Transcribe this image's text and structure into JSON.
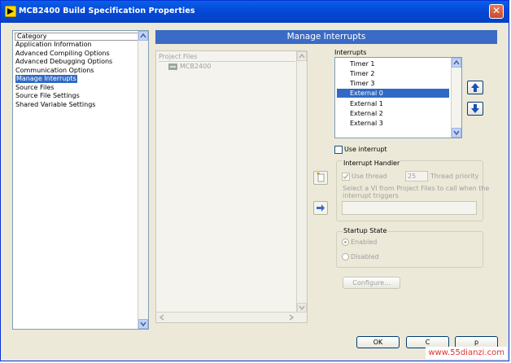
{
  "window": {
    "title": "MCB2400 Build Specification Properties"
  },
  "category": {
    "header": "Category",
    "items": [
      "Application Information",
      "Advanced Compiling Options",
      "Advanced Debugging Options",
      "Communication Options",
      "Manage Interrupts",
      "Source Files",
      "Source File Settings",
      "Shared Variable Settings"
    ],
    "selected": "Manage Interrupts"
  },
  "page": {
    "banner": "Manage Interrupts"
  },
  "project_files": {
    "header": "Project Files",
    "root": "MCB2400"
  },
  "interrupts": {
    "label": "Interrupts",
    "items": [
      "Timer 1",
      "Timer 2",
      "Timer 3",
      "External 0",
      "External 1",
      "External 2",
      "External 3"
    ],
    "selected": "External 0"
  },
  "use_interrupt": {
    "label": "Use interrupt",
    "checked": false
  },
  "handler": {
    "title": "Interrupt Handler",
    "use_thread_label": "Use thread",
    "use_thread_checked": true,
    "thread_priority_value": "25",
    "thread_priority_label": "Thread priority",
    "help_line1": "Select a VI from Project Files to call when the",
    "help_line2": "interrupt triggers",
    "vi_path": ""
  },
  "startup": {
    "title": "Startup State",
    "enabled_label": "Enabled",
    "disabled_label": "Disabled",
    "selected": "Enabled"
  },
  "buttons": {
    "configure": "Configure...",
    "ok": "OK",
    "cancel": "C",
    "help": "p"
  },
  "watermark": "www.55dianzi.com",
  "colors": {
    "title_bar": "#0349d8",
    "selection": "#316ac5",
    "banner": "#3a6bc5",
    "watermark": "#e03030"
  }
}
